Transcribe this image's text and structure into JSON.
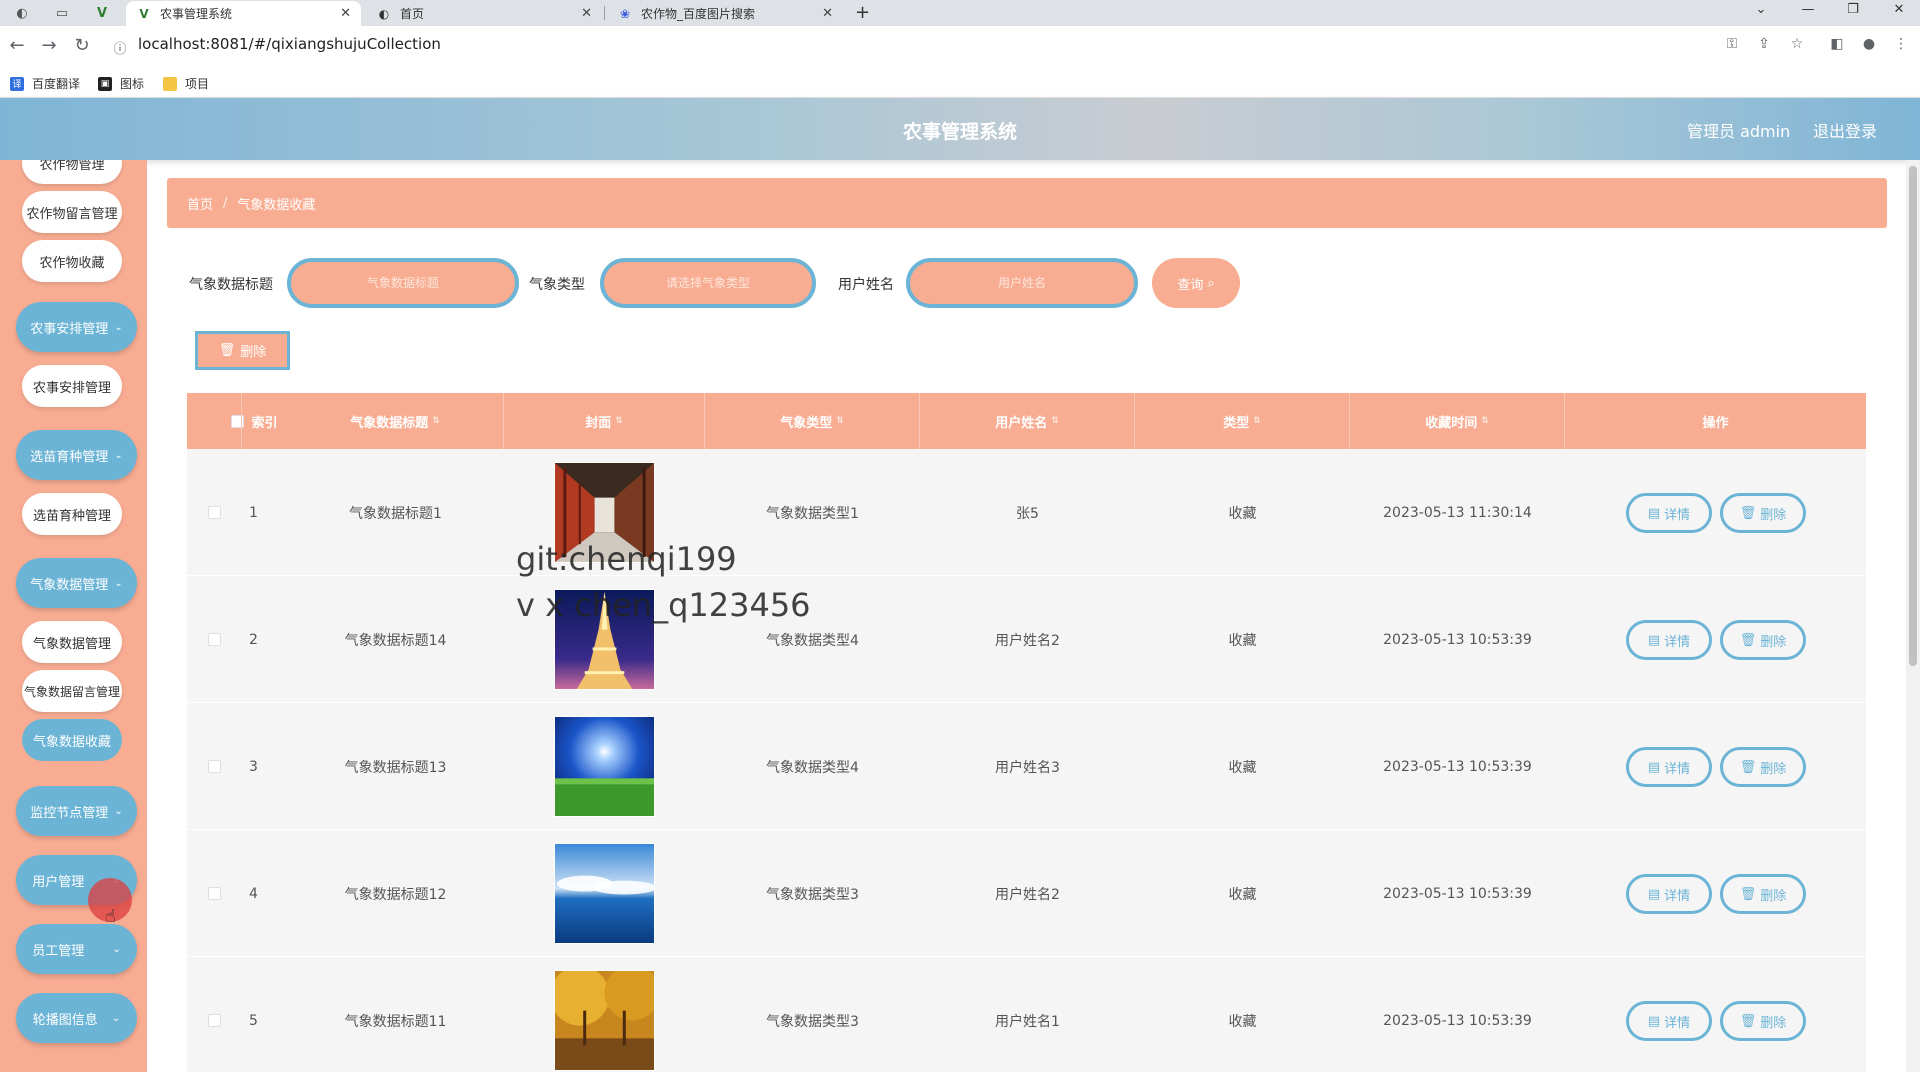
{
  "browser": {
    "tabs": [
      {
        "title": "农事管理系统",
        "active": true
      },
      {
        "title": "首页",
        "active": false
      },
      {
        "title": "农作物_百度图片搜索",
        "active": false
      }
    ],
    "url": "localhost:8081/#/qixiangshujuCollection",
    "bookmarks": [
      "百度翻译",
      "图标",
      "项目"
    ]
  },
  "header": {
    "title": "农事管理系统",
    "admin": "管理员 admin",
    "logout": "退出登录"
  },
  "sidebar": {
    "items": [
      {
        "label": "农作物管理",
        "kind": "sub"
      },
      {
        "label": "农作物留言管理",
        "kind": "sub"
      },
      {
        "label": "农作物收藏",
        "kind": "sub"
      },
      {
        "label": "农事安排管理",
        "kind": "group"
      },
      {
        "label": "农事安排管理",
        "kind": "sub"
      },
      {
        "label": "选苗育种管理",
        "kind": "group"
      },
      {
        "label": "选苗育种管理",
        "kind": "sub"
      },
      {
        "label": "气象数据管理",
        "kind": "group"
      },
      {
        "label": "气象数据管理",
        "kind": "sub"
      },
      {
        "label": "气象数据留言管理",
        "kind": "sub"
      },
      {
        "label": "气象数据收藏",
        "kind": "active"
      },
      {
        "label": "监控节点管理",
        "kind": "group"
      },
      {
        "label": "用户管理",
        "kind": "group"
      },
      {
        "label": "员工管理",
        "kind": "group"
      },
      {
        "label": "轮播图信息",
        "kind": "group"
      }
    ]
  },
  "breadcrumb": {
    "home": "首页",
    "current": "气象数据收藏"
  },
  "filters": {
    "title_label": "气象数据标题",
    "title_placeholder": "气象数据标题",
    "type_label": "气象类型",
    "type_placeholder": "请选择气象类型",
    "user_label": "用户姓名",
    "user_placeholder": "用户姓名",
    "query": "查询"
  },
  "actions": {
    "bulk_delete": "删除",
    "detail": "详情",
    "delete": "删除"
  },
  "table": {
    "headers": [
      "索引",
      "气象数据标题",
      "封面",
      "气象类型",
      "用户姓名",
      "类型",
      "收藏时间",
      "操作"
    ],
    "rows": [
      {
        "index": "1",
        "title": "气象数据标题1",
        "type": "气象数据类型1",
        "user": "张5",
        "kind": "收藏",
        "time": "2023-05-13 11:30:14",
        "cover": "corridor"
      },
      {
        "index": "2",
        "title": "气象数据标题14",
        "type": "气象数据类型4",
        "user": "用户姓名2",
        "kind": "收藏",
        "time": "2023-05-13 10:53:39",
        "cover": "tower"
      },
      {
        "index": "3",
        "title": "气象数据标题13",
        "type": "气象数据类型4",
        "user": "用户姓名3",
        "kind": "收藏",
        "time": "2023-05-13 10:53:39",
        "cover": "field"
      },
      {
        "index": "4",
        "title": "气象数据标题12",
        "type": "气象数据类型3",
        "user": "用户姓名2",
        "kind": "收藏",
        "time": "2023-05-13 10:53:39",
        "cover": "sea"
      },
      {
        "index": "5",
        "title": "气象数据标题11",
        "type": "气象数据类型3",
        "user": "用户姓名1",
        "kind": "收藏",
        "time": "2023-05-13 10:53:39",
        "cover": "autumn"
      }
    ]
  },
  "watermark": {
    "line1": "git:chenqi199",
    "line2": "v x chen_q123456"
  }
}
